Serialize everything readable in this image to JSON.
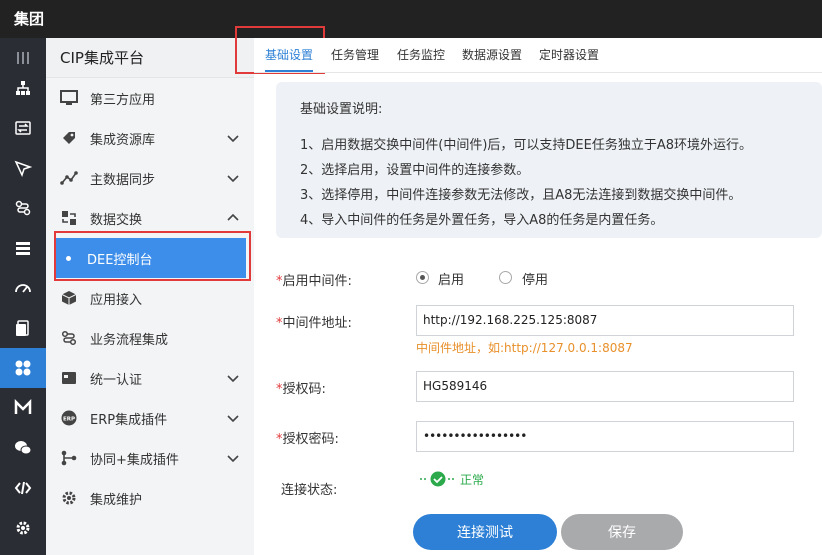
{
  "header": {
    "brand": "集团"
  },
  "sidebar": {
    "title": "CIP集成平台",
    "items": [
      {
        "label": "第三方应用",
        "icon": "monitor-icon"
      },
      {
        "label": "集成资源库",
        "icon": "tag-icon"
      },
      {
        "label": "主数据同步",
        "icon": "line-chart-icon"
      },
      {
        "label": "数据交换",
        "icon": "exchange-icon"
      },
      {
        "label": "DEE控制台",
        "icon": "dot-icon"
      },
      {
        "label": "应用接入",
        "icon": "cube-icon"
      },
      {
        "label": "业务流程集成",
        "icon": "flow-icon"
      },
      {
        "label": "统一认证",
        "icon": "card-icon"
      },
      {
        "label": "ERP集成插件",
        "icon": "erp-icon"
      },
      {
        "label": "协同+集成插件",
        "icon": "plugin-icon"
      },
      {
        "label": "集成维护",
        "icon": "gear-icon"
      }
    ]
  },
  "tabs": [
    "基础设置",
    "任务管理",
    "任务监控",
    "数据源设置",
    "定时器设置"
  ],
  "info": {
    "title": "基础设置说明:",
    "lines": [
      "1、启用数据交换中间件(中间件)后，可以支持DEE任务独立于A8环境外运行。",
      "2、选择启用，设置中间件的连接参数。",
      "3、选择停用，中间件连接参数无法修改，且A8无法连接到数据交换中间件。",
      "4、导入中间件的任务是外置任务，导入A8的任务是内置任务。"
    ]
  },
  "form": {
    "enable_label": "启用中间件:",
    "enable_on": "启用",
    "enable_off": "停用",
    "address_label": "中间件地址:",
    "address_value": "http://192.168.225.125:8087",
    "address_hint": "中间件地址，如:http://127.0.0.1:8087",
    "code_label": "授权码:",
    "code_value": "HG589146",
    "password_label": "授权密码:",
    "password_value": "•••••••••••••••••",
    "status_label": "连接状态:",
    "status_value": "正常",
    "required_mark": "*"
  },
  "buttons": {
    "test": "连接测试",
    "save": "保存"
  },
  "colors": {
    "accent": "#2d80d6",
    "success": "#2ba94b",
    "hint": "#e8902a",
    "highlight": "#e03a3a"
  }
}
